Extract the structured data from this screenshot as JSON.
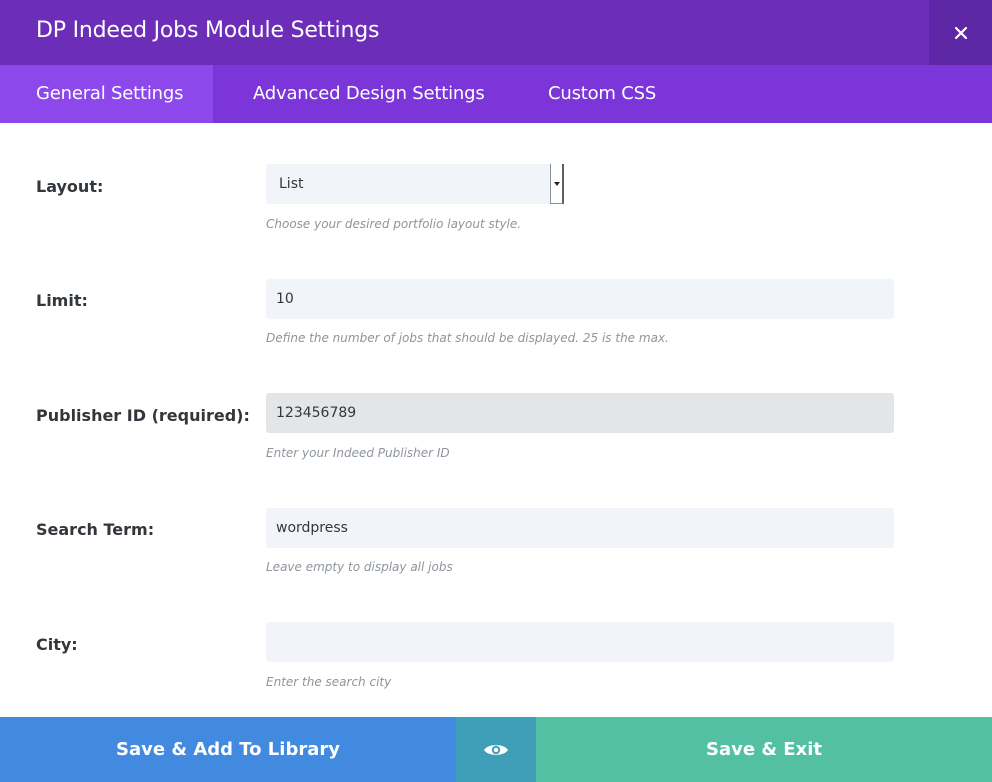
{
  "modal": {
    "title": "DP Indeed Jobs Module Settings",
    "close_icon": "close-icon"
  },
  "tabs": [
    {
      "label": "General Settings",
      "active": true
    },
    {
      "label": "Advanced Design Settings",
      "active": false
    },
    {
      "label": "Custom CSS",
      "active": false
    }
  ],
  "fields": {
    "layout": {
      "label": "Layout:",
      "value": "List",
      "description": "Choose your desired portfolio layout style."
    },
    "limit": {
      "label": "Limit:",
      "value": "10",
      "description": "Define the number of jobs that should be displayed. 25 is the max."
    },
    "publisher_id": {
      "label": "Publisher ID (required):",
      "value": "123456789",
      "description": "Enter your Indeed Publisher ID"
    },
    "search_term": {
      "label": "Search Term:",
      "value": "wordpress",
      "description": "Leave empty to display all jobs"
    },
    "city": {
      "label": "City:",
      "value": "",
      "description": "Enter the search city"
    }
  },
  "footer": {
    "save_library_label": "Save & Add To Library",
    "preview_icon": "eye-icon",
    "save_exit_label": "Save & Exit"
  },
  "colors": {
    "header": "#6c2eb9",
    "tabs": "#7b35d8",
    "active_tab": "#8d48eb",
    "save_library": "#4289e0",
    "preview": "#3f9eb8",
    "save_exit": "#53c0a3"
  }
}
